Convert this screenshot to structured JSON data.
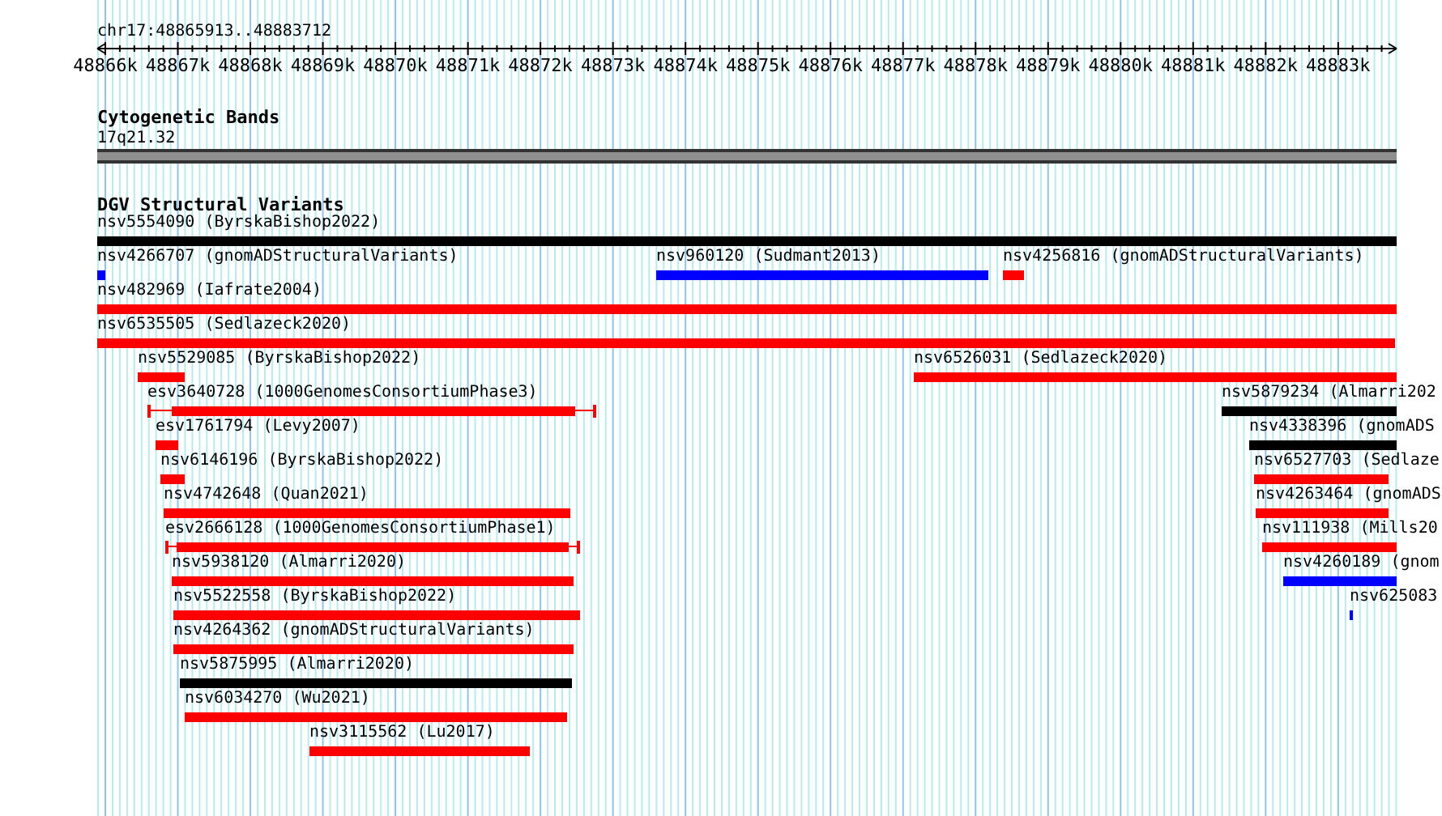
{
  "ruler": {
    "title": "chr17:48865913..48883712",
    "tick_labels": [
      "48866k",
      "48867k",
      "48868k",
      "48869k",
      "48870k",
      "48871k",
      "48872k",
      "48873k",
      "48874k",
      "48875k",
      "48876k",
      "48877k",
      "48878k",
      "48879k",
      "48880k",
      "48881k",
      "48882k",
      "48883k"
    ]
  },
  "tracks": [
    {
      "kind": "cytoband",
      "title": "Cytogenetic Bands",
      "band_label": "17q21.32"
    },
    {
      "kind": "features",
      "title": "DGV Structural Variants",
      "features": [
        {
          "label": "nsv5554090 (ByrskaBishop2022)",
          "color": "#000000",
          "kind": "bar"
        },
        {
          "label": "nsv4266707 (gnomADStructuralVariants)",
          "color": "#0000ff",
          "kind": "bar"
        },
        {
          "label": "nsv960120 (Sudmant2013)",
          "color": "#0000ff",
          "kind": "bar"
        },
        {
          "label": "nsv4256816 (gnomADStructuralVariants)",
          "color": "#ff0000",
          "kind": "bar"
        },
        {
          "label": "nsv482969 (Iafrate2004)",
          "color": "#ff0000",
          "kind": "bar"
        },
        {
          "label": "nsv6535505 (Sedlazeck2020)",
          "color": "#ff0000",
          "kind": "bar"
        },
        {
          "label": "nsv5529085 (ByrskaBishop2022)",
          "color": "#ff0000",
          "kind": "bar"
        },
        {
          "label": "nsv6526031 (Sedlazeck2020)",
          "color": "#ff0000",
          "kind": "bar"
        },
        {
          "label": "esv3640728 (1000GenomesConsortiumPhase3)",
          "color": "#ff0000",
          "kind": "range"
        },
        {
          "label": "nsv5879234 (Almarri202",
          "color": "#000000",
          "kind": "bar"
        },
        {
          "label": "esv1761794 (Levy2007)",
          "color": "#ff0000",
          "kind": "bar"
        },
        {
          "label": "nsv4338396 (gnomADS",
          "color": "#000000",
          "kind": "bar"
        },
        {
          "label": "nsv6146196 (ByrskaBishop2022)",
          "color": "#ff0000",
          "kind": "bar"
        },
        {
          "label": "nsv6527703 (Sedlaze",
          "color": "#ff0000",
          "kind": "bar"
        },
        {
          "label": "nsv4742648 (Quan2021)",
          "color": "#ff0000",
          "kind": "bar"
        },
        {
          "label": "nsv4263464 (gnomADS",
          "color": "#ff0000",
          "kind": "bar"
        },
        {
          "label": "esv2666128 (1000GenomesConsortiumPhase1)",
          "color": "#ff0000",
          "kind": "range"
        },
        {
          "label": "nsv111938 (Mills20",
          "color": "#ff0000",
          "kind": "bar"
        },
        {
          "label": "nsv5938120 (Almarri2020)",
          "color": "#ff0000",
          "kind": "bar"
        },
        {
          "label": "nsv4260189 (gnom",
          "color": "#0000ff",
          "kind": "bar"
        },
        {
          "label": "nsv5522558 (ByrskaBishop2022)",
          "color": "#ff0000",
          "kind": "bar"
        },
        {
          "label": "nsv625083",
          "color": "#0000ff",
          "kind": "bar"
        },
        {
          "label": "nsv4264362 (gnomADStructuralVariants)",
          "color": "#ff0000",
          "kind": "bar"
        },
        {
          "label": "nsv5875995 (Almarri2020)",
          "color": "#000000",
          "kind": "bar"
        },
        {
          "label": "nsv6034270 (Wu2021)",
          "color": "#ff0000",
          "kind": "bar"
        },
        {
          "label": "nsv3115562 (Lu2017)",
          "color": "#ff0000",
          "kind": "bar"
        }
      ]
    }
  ]
}
